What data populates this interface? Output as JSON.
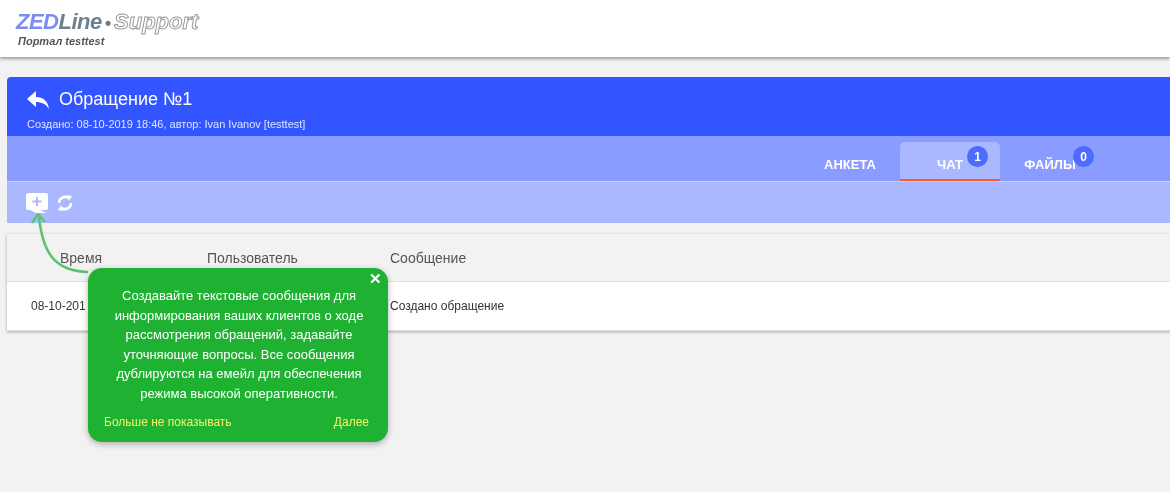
{
  "logo": {
    "brand": "ZEDLine",
    "separator": "•",
    "product": "Support",
    "subtitle": "Портал testtest"
  },
  "ticket": {
    "title": "Обращение №1",
    "meta": "Создано: 08-10-2019 18:46, автор: Ivan Ivanov [testtest]"
  },
  "tabs": [
    {
      "label": "АНКЕТА",
      "selected": false
    },
    {
      "label": "ЧАТ",
      "selected": true,
      "count": "1"
    },
    {
      "label": "ФАЙЛЫ",
      "selected": false,
      "count": "0"
    }
  ],
  "table": {
    "columns": [
      "Время",
      "Пользователь",
      "Сообщение"
    ],
    "rows": [
      {
        "time": "08-10-201",
        "message": "Создано обращение"
      }
    ]
  },
  "hint": {
    "close": "✕",
    "text": "Создавайте текстовые сообщения для информирования ваших клиентов о ходе рассмотрения обращений, задавайте уточняющие вопросы. Все сообщения дублируются на емейл для обеспечения режима высокой оперативности.",
    "dismiss": "Больше не показывать",
    "next": "Далее"
  }
}
